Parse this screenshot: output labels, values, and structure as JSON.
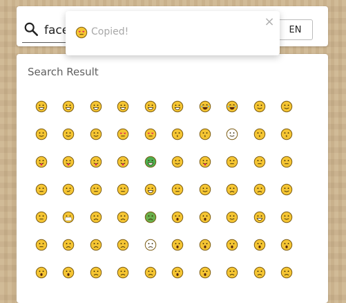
{
  "search": {
    "query": "face",
    "lang_label": "EN"
  },
  "results": {
    "title": "Search Result",
    "emojis": [
      [
        {
          "name": "grinning-face",
          "color": "#f5c533",
          "mood": "grin"
        },
        {
          "name": "grinning-face-big-eyes",
          "color": "#f5c533",
          "mood": "grin"
        },
        {
          "name": "grinning-face-smiling-eyes",
          "color": "#f5c533",
          "mood": "grin"
        },
        {
          "name": "beaming-face",
          "color": "#f5c533",
          "mood": "grin"
        },
        {
          "name": "grinning-squinting-face",
          "color": "#f5c533",
          "mood": "grin"
        },
        {
          "name": "grinning-face-sweat",
          "color": "#f5c533",
          "mood": "grin"
        },
        {
          "name": "rolling-on-floor-laughing",
          "color": "#f5c533",
          "mood": "laugh"
        },
        {
          "name": "face-tears-of-joy",
          "color": "#f5c533",
          "mood": "laugh"
        },
        {
          "name": "slightly-smiling-face",
          "color": "#f5c533",
          "mood": "smile"
        },
        {
          "name": "upside-down-face",
          "color": "#f5c533",
          "mood": "smile"
        }
      ],
      [
        {
          "name": "winking-face",
          "color": "#f5c533",
          "mood": "smile"
        },
        {
          "name": "smiling-face-smiling-eyes",
          "color": "#f5c533",
          "mood": "smile"
        },
        {
          "name": "smiling-face-halo",
          "color": "#f5c533",
          "mood": "smile"
        },
        {
          "name": "smiling-face-heart-eyes",
          "color": "#f5c533",
          "mood": "heart"
        },
        {
          "name": "star-struck",
          "color": "#f5c533",
          "mood": "heart"
        },
        {
          "name": "face-blowing-kiss",
          "color": "#f5c533",
          "mood": "kiss"
        },
        {
          "name": "kissing-face",
          "color": "#f5c533",
          "mood": "kiss"
        },
        {
          "name": "smiling-face",
          "color": "#ffffff",
          "mood": "smile"
        },
        {
          "name": "kissing-face-closed-eyes",
          "color": "#f5c533",
          "mood": "kiss"
        },
        {
          "name": "kissing-face-smiling-eyes",
          "color": "#f5c533",
          "mood": "kiss"
        }
      ],
      [
        {
          "name": "face-savoring-food",
          "color": "#f5c533",
          "mood": "tongue"
        },
        {
          "name": "face-with-tongue",
          "color": "#f5c533",
          "mood": "tongue"
        },
        {
          "name": "winking-face-tongue",
          "color": "#f5c533",
          "mood": "tongue"
        },
        {
          "name": "squinting-face-tongue",
          "color": "#f5c533",
          "mood": "tongue"
        },
        {
          "name": "money-mouth-face",
          "color": "#4caf50",
          "mood": "grin"
        },
        {
          "name": "hugging-face",
          "color": "#f5c533",
          "mood": "smile"
        },
        {
          "name": "zany-face",
          "color": "#f5c533",
          "mood": "tongue"
        },
        {
          "name": "shushing-face",
          "color": "#f5c533",
          "mood": "neutral"
        },
        {
          "name": "thinking-face",
          "color": "#f5c533",
          "mood": "neutral"
        },
        {
          "name": "zipper-mouth-face",
          "color": "#f5c533",
          "mood": "neutral"
        }
      ],
      [
        {
          "name": "face-without-mouth",
          "color": "#f5c533",
          "mood": "neutral"
        },
        {
          "name": "smirking-face",
          "color": "#f5c533",
          "mood": "smirk"
        },
        {
          "name": "unamused-face",
          "color": "#f5c533",
          "mood": "neutral"
        },
        {
          "name": "face-with-rolling-eyes",
          "color": "#f5c533",
          "mood": "neutral"
        },
        {
          "name": "grimacing-face",
          "color": "#f5c533",
          "mood": "grin"
        },
        {
          "name": "lying-face",
          "color": "#f5c533",
          "mood": "neutral"
        },
        {
          "name": "relieved-face",
          "color": "#f5c533",
          "mood": "smile"
        },
        {
          "name": "pensive-face",
          "color": "#f5c533",
          "mood": "sad"
        },
        {
          "name": "sleepy-face",
          "color": "#f5c533",
          "mood": "sad"
        },
        {
          "name": "drooling-face",
          "color": "#f5c533",
          "mood": "smile"
        }
      ],
      [
        {
          "name": "sleeping-face",
          "color": "#f5c533",
          "mood": "neutral"
        },
        {
          "name": "face-with-medical-mask",
          "color": "#f5c533",
          "mood": "mask"
        },
        {
          "name": "face-with-thermometer",
          "color": "#f5c533",
          "mood": "sad"
        },
        {
          "name": "face-with-head-bandage",
          "color": "#f5c533",
          "mood": "sad"
        },
        {
          "name": "nauseated-face",
          "color": "#6ab04c",
          "mood": "sad"
        },
        {
          "name": "face-vomiting",
          "color": "#f5c533",
          "mood": "open"
        },
        {
          "name": "sneezing-face",
          "color": "#f5c533",
          "mood": "open"
        },
        {
          "name": "cowboy-hat-face",
          "color": "#f5c533",
          "mood": "smile"
        },
        {
          "name": "nerd-face",
          "color": "#f5c533",
          "mood": "grin"
        },
        {
          "name": "smiling-face-sunglasses",
          "color": "#f5c533",
          "mood": "smile"
        }
      ],
      [
        {
          "name": "face-with-monocle",
          "color": "#f5c533",
          "mood": "neutral"
        },
        {
          "name": "confused-face",
          "color": "#f5c533",
          "mood": "sad"
        },
        {
          "name": "worried-face",
          "color": "#f5c533",
          "mood": "sad"
        },
        {
          "name": "slightly-frowning-face",
          "color": "#f5c533",
          "mood": "sad"
        },
        {
          "name": "frowning-face",
          "color": "#ffffff",
          "mood": "sad"
        },
        {
          "name": "face-open-mouth",
          "color": "#f5c533",
          "mood": "open"
        },
        {
          "name": "hushed-face",
          "color": "#f5c533",
          "mood": "open"
        },
        {
          "name": "astonished-face",
          "color": "#f5c533",
          "mood": "open"
        },
        {
          "name": "flushed-face",
          "color": "#f5c533",
          "mood": "open"
        },
        {
          "name": "frowning-face-open-mouth",
          "color": "#f5c533",
          "mood": "open"
        }
      ],
      [
        {
          "name": "anguished-face",
          "color": "#f5c533",
          "mood": "open"
        },
        {
          "name": "fearful-face",
          "color": "#f5c533",
          "mood": "open"
        },
        {
          "name": "anxious-face-sweat",
          "color": "#f5c533",
          "mood": "sad"
        },
        {
          "name": "sad-relieved-face",
          "color": "#f5c533",
          "mood": "sad"
        },
        {
          "name": "crying-face",
          "color": "#f5c533",
          "mood": "sad"
        },
        {
          "name": "loudly-crying-face",
          "color": "#f5c533",
          "mood": "open"
        },
        {
          "name": "face-screaming-in-fear",
          "color": "#f5c533",
          "mood": "open"
        },
        {
          "name": "confounded-face",
          "color": "#f5c533",
          "mood": "sad"
        },
        {
          "name": "persevering-face",
          "color": "#f5c533",
          "mood": "sad"
        },
        {
          "name": "disappointed-face",
          "color": "#f5c533",
          "mood": "sad"
        }
      ]
    ]
  },
  "toast": {
    "text": "Copied!",
    "close_glyph": "×",
    "emoji": {
      "name": "smiling-face-heart-eyes",
      "color": "#f5c533",
      "mood": "heart"
    }
  }
}
